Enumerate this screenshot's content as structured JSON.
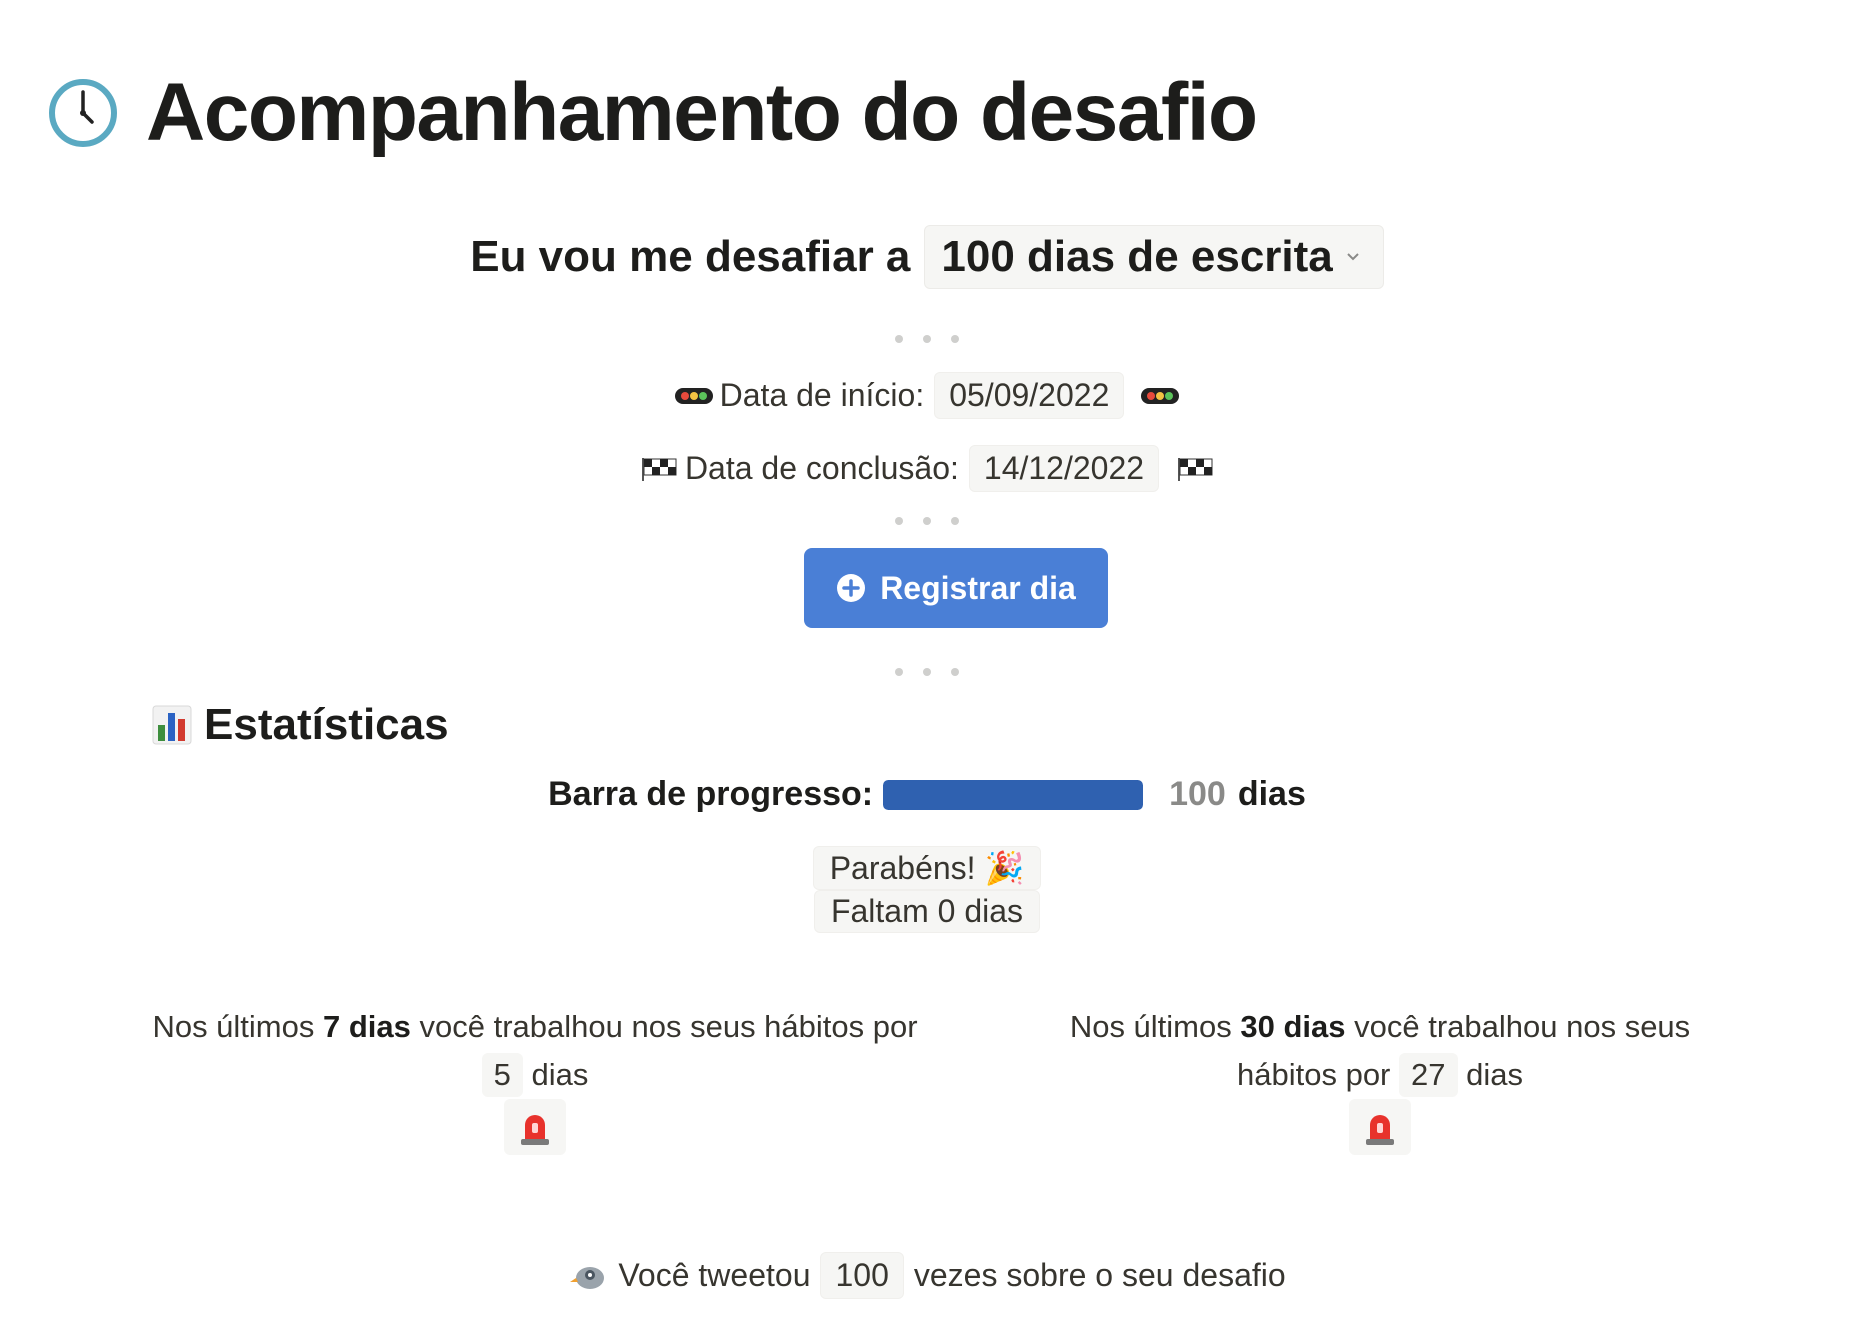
{
  "page": {
    "title": "Acompanhamento do desafio",
    "title_icon": "clock-icon"
  },
  "challenge": {
    "prefix": "Eu vou me desafiar a",
    "selected_value": "100 dias de escrita"
  },
  "dates": {
    "start_label": "Data de início:",
    "start_value": "05/09/2022",
    "end_label": "Data de conclusão:",
    "end_value": "14/12/2022"
  },
  "register_button": {
    "label": "Registrar dia"
  },
  "stats": {
    "section_title": "Estatísticas",
    "progress_label": "Barra de progresso:",
    "progress_value": "100",
    "progress_unit": "dias",
    "progress_fraction": 1.0,
    "congrats": "Parabéns! 🎉",
    "remaining": "Faltam 0 dias",
    "week": {
      "prefix": "Nos últimos",
      "period": "7 dias",
      "middle": "você trabalhou nos seus hábitos por",
      "count": "5",
      "suffix": "dias"
    },
    "month": {
      "prefix": "Nos últimos",
      "period": "30 dias",
      "middle": "você trabalhou nos seus hábitos por",
      "count": "27",
      "suffix": "dias"
    }
  },
  "tweets": {
    "prefix": "Você tweetou",
    "count": "100",
    "suffix": "vezes sobre o seu desafio"
  },
  "colors": {
    "button": "#4a7fd6",
    "progress_fill": "#2f61b0",
    "chip_bg": "#f6f6f4"
  }
}
